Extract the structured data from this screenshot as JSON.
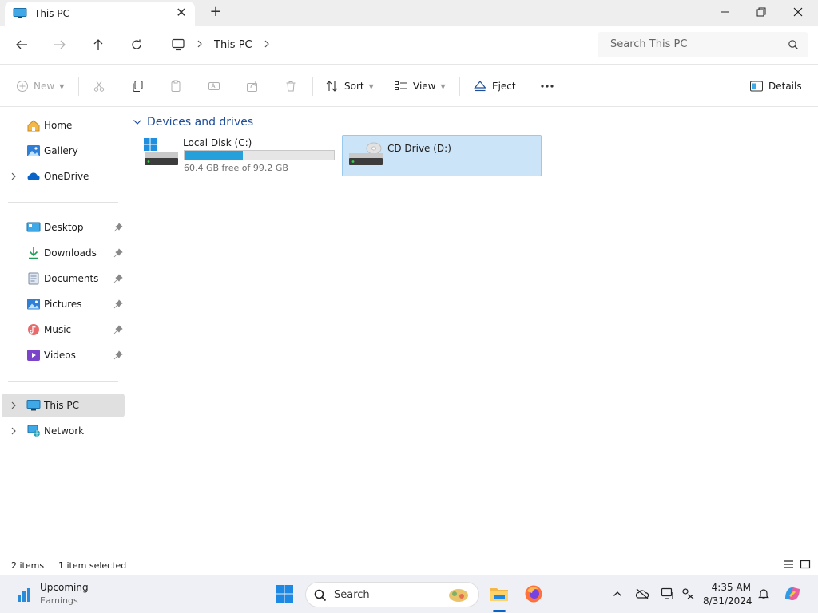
{
  "window": {
    "tab_title": "This PC"
  },
  "address": {
    "crumbs": [
      "This PC"
    ],
    "search_placeholder": "Search This PC"
  },
  "commands": {
    "new": "New",
    "sort": "Sort",
    "view": "View",
    "eject": "Eject",
    "details": "Details"
  },
  "sidebar": {
    "items": [
      {
        "label": "Home",
        "icon": "home-icon"
      },
      {
        "label": "Gallery",
        "icon": "gallery-icon"
      },
      {
        "label": "OneDrive",
        "icon": "onedrive-icon"
      },
      {
        "label": "Desktop",
        "icon": "desktop-icon"
      },
      {
        "label": "Downloads",
        "icon": "downloads-icon"
      },
      {
        "label": "Documents",
        "icon": "documents-icon"
      },
      {
        "label": "Pictures",
        "icon": "pictures-icon"
      },
      {
        "label": "Music",
        "icon": "music-icon"
      },
      {
        "label": "Videos",
        "icon": "videos-icon"
      },
      {
        "label": "This PC",
        "icon": "this-pc-icon",
        "selected": true
      },
      {
        "label": "Network",
        "icon": "network-icon"
      }
    ]
  },
  "content": {
    "group_title": "Devices and drives",
    "drives": [
      {
        "name": "Local Disk (C:)",
        "free_text": "60.4 GB free of 99.2 GB",
        "used_fraction": 0.39,
        "selected": false
      },
      {
        "name": "CD Drive (D:)",
        "selected": true
      }
    ]
  },
  "status": {
    "count": "2 items",
    "selection": "1 item selected"
  },
  "taskbar": {
    "weather_title": "Upcoming",
    "weather_sub": "Earnings",
    "search": "Search",
    "time": "4:35 AM",
    "date": "8/31/2024"
  },
  "colors": {
    "accent": "#0067c0",
    "selection": "#cce4f7",
    "progress": "#26a0da"
  }
}
